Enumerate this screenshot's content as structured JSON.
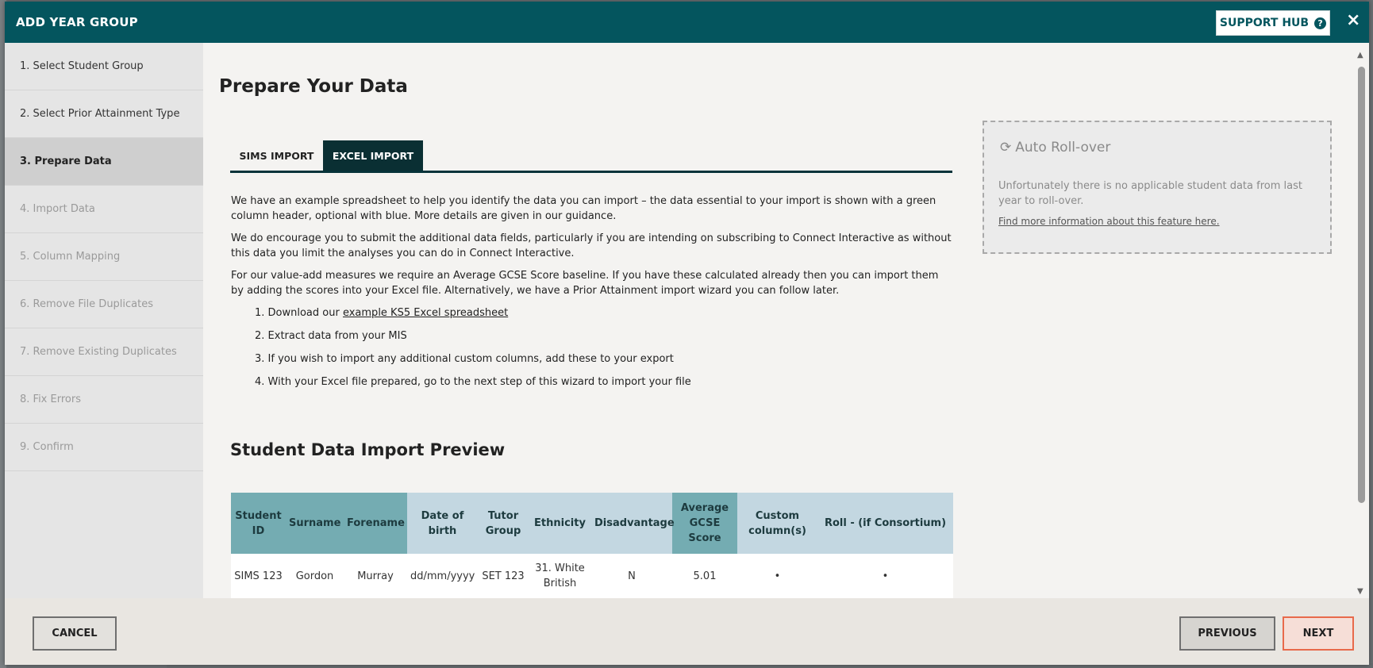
{
  "header": {
    "title": "ADD YEAR GROUP",
    "support_label": "SUPPORT HUB",
    "close_symbol": "×"
  },
  "sidebar": {
    "steps": [
      {
        "label": "1. Select Student Group",
        "state": "done"
      },
      {
        "label": "2. Select Prior Attainment Type",
        "state": "done"
      },
      {
        "label": "3. Prepare Data",
        "state": "active"
      },
      {
        "label": "4. Import Data",
        "state": "disabled"
      },
      {
        "label": "5. Column Mapping",
        "state": "disabled"
      },
      {
        "label": "6. Remove File Duplicates",
        "state": "disabled"
      },
      {
        "label": "7. Remove Existing Duplicates",
        "state": "disabled"
      },
      {
        "label": "8. Fix Errors",
        "state": "disabled"
      },
      {
        "label": "9. Confirm",
        "state": "disabled"
      }
    ]
  },
  "main": {
    "title": "Prepare Your Data",
    "tabs": [
      {
        "label": "SIMS IMPORT",
        "active": false
      },
      {
        "label": "EXCEL IMPORT",
        "active": true
      }
    ],
    "paragraphs": [
      "We have an example spreadsheet to help you identify the data you can import – the data essential to your import is shown with a green column header, optional with blue. More details are given in our guidance.",
      "We do encourage you to submit the additional data fields, particularly if you are intending on subscribing to Connect Interactive as without this data you limit the analyses you can do in Connect Interactive.",
      "For our value-add measures we require an Average GCSE Score baseline. If you have these calculated already then you can import them by adding the scores into your Excel file. Alternatively, we have a Prior Attainment import wizard you can follow later."
    ],
    "steps": {
      "step1_prefix": "1. Download our ",
      "step1_link": "example KS5 Excel spreadsheet",
      "step2": "2. Extract data from your MIS",
      "step3": "3. If you wish to import any additional custom columns, add these to your export",
      "step4": "4. With your Excel file prepared, go to the next step of this wizard to import your file"
    },
    "preview_title": "Student Data Import Preview",
    "table": {
      "headers": [
        {
          "label": "Student ID",
          "type": "essential"
        },
        {
          "label": "Surname",
          "type": "essential"
        },
        {
          "label": "Forename",
          "type": "essential"
        },
        {
          "label": "Date of birth",
          "type": "optional"
        },
        {
          "label": "Tutor Group",
          "type": "optional"
        },
        {
          "label": "Ethnicity",
          "type": "optional"
        },
        {
          "label": "Disadvantage",
          "type": "optional"
        },
        {
          "label": "Average GCSE Score",
          "type": "essential"
        },
        {
          "label": "Custom column(s)",
          "type": "optional"
        },
        {
          "label": "Roll - (if Consortium)",
          "type": "optional"
        }
      ],
      "row": [
        "SIMS 123",
        "Gordon",
        "Murray",
        "dd/mm/yyyy",
        "SET 123",
        "31. White British",
        "N",
        "5.01",
        "•",
        "•"
      ]
    }
  },
  "rollover": {
    "title": "Auto Roll-over",
    "text": "Unfortunately there is no applicable student data from last year to roll-over.",
    "link": "Find more information about this feature here."
  },
  "footer": {
    "cancel_label": "CANCEL",
    "previous_label": "PREVIOUS",
    "next_label": "NEXT"
  },
  "colors": {
    "header_bg": "#04555e",
    "essential_header": "#74acb2",
    "optional_header": "#c3d7e1",
    "active_tab": "#0a2f33",
    "next_border": "#e86a4b"
  },
  "icons": {
    "help": "question-circle-icon",
    "close": "close-icon",
    "refresh": "refresh-icon"
  }
}
